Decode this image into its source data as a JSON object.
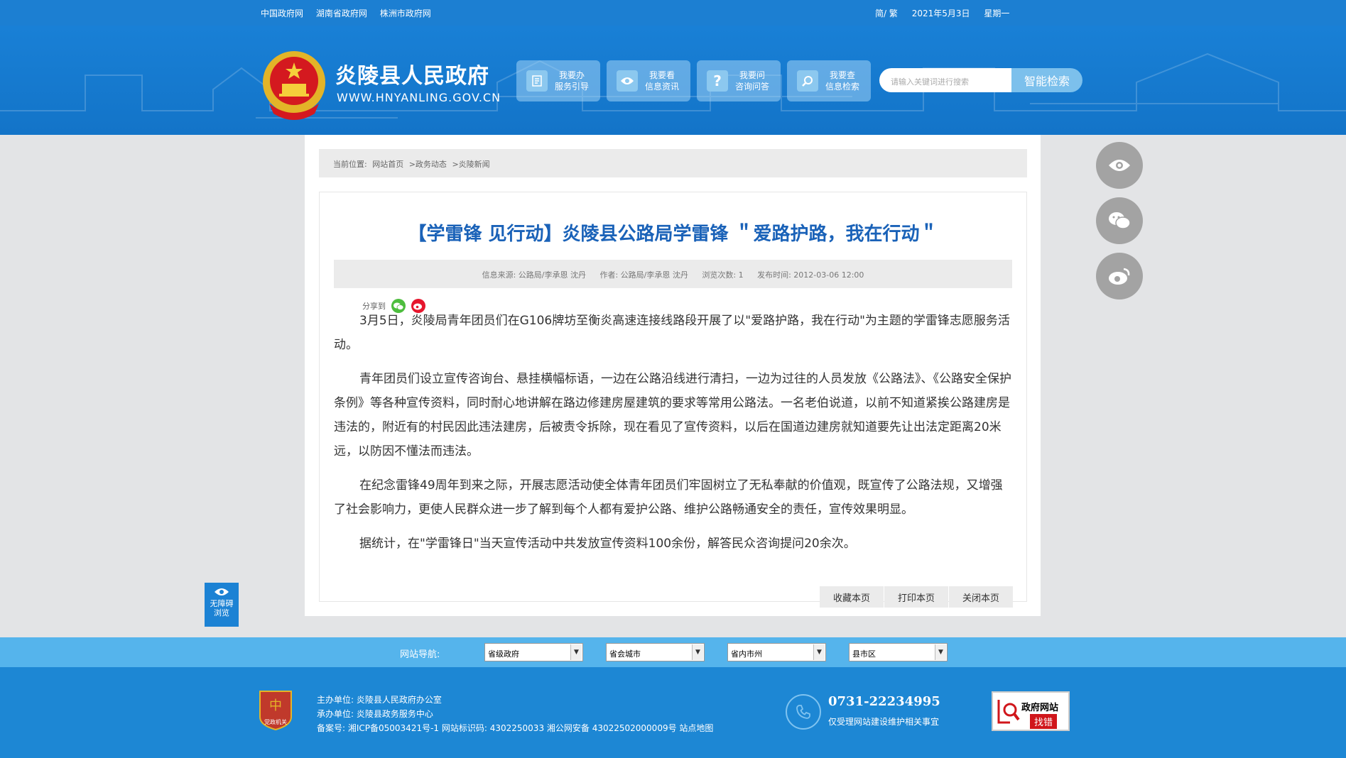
{
  "topbar": {
    "links": [
      "中国政府网",
      "湖南省政府网",
      "株洲市政府网"
    ],
    "script_toggle": "简/ 繁",
    "date": "2021年5月3日",
    "weekday": "星期一"
  },
  "header": {
    "site_name": "炎陵县人民政府",
    "site_url": "WWW.HNYANLING.GOV.CN",
    "buttons": [
      {
        "line1": "我要办",
        "line2": "服务引导",
        "icon": "document-icon"
      },
      {
        "line1": "我要看",
        "line2": "信息资讯",
        "icon": "eye-icon"
      },
      {
        "line1": "我要问",
        "line2": "咨询问答",
        "icon": "question-icon"
      },
      {
        "line1": "我要查",
        "line2": "信息检索",
        "icon": "search-icon"
      }
    ],
    "search_placeholder": "请输入关键词进行搜索",
    "search_button": "智能检索"
  },
  "breadcrumb": {
    "prefix": "当前位置:",
    "items": [
      "网站首页",
      ">政务动态",
      ">炎陵新闻"
    ]
  },
  "article": {
    "title": "【学雷锋 见行动】炎陵县公路局学雷锋 ＂爱路护路，我在行动＂",
    "meta": {
      "source": "信息来源:  公路局/李承恩 沈丹",
      "author": "作者:  公路局/李承恩 沈丹",
      "views": "浏览次数:  1",
      "date": "发布时间:  2012-03-06 12:00"
    },
    "share_label": "分享到",
    "paragraphs": [
      "3月5日，炎陵局青年团员们在G106牌坊至衡炎高速连接线路段开展了以\"爱路护路，我在行动\"为主题的学雷锋志愿服务活动。",
      "青年团员们设立宣传咨询台、悬挂横幅标语，一边在公路沿线进行清扫，一边为过往的人员发放《公路法》、《公路安全保护条例》等各种宣传资料，同时耐心地讲解在路边修建房屋建筑的要求等常用公路法。一名老伯说道，以前不知道紧挨公路建房是违法的，附近有的村民因此违法建房，后被责令拆除，现在看见了宣传资料，以后在国道边建房就知道要先让出法定距离20米远，以防因不懂法而违法。",
      "在纪念雷锋49周年到来之际，开展志愿活动使全体青年团员们牢固树立了无私奉献的价值观，既宣传了公路法规，又增强了社会影响力，更使人民群众进一步了解到每个人都有爱护公路、维护公路畅通安全的责任，宣传效果明显。",
      "据统计，在\"学雷锋日\"当天宣传活动中共发放宣传资料100余份，解答民众咨询提问20余次。"
    ],
    "actions": [
      "收藏本页",
      "打印本页",
      "关闭本页"
    ]
  },
  "floating": {
    "accessibility_line1": "无障碍",
    "accessibility_line2": "浏览"
  },
  "site_nav": {
    "label": "网站导航:",
    "selects": [
      "省级政府",
      "省会城市",
      "省内市州",
      "县市区"
    ]
  },
  "footer": {
    "host": "主办单位:  炎陵县人民政府办公室",
    "organizer": "承办单位:  炎陵县政务服务中心",
    "record": "备案号:  湘ICP备05003421号-1  网站标识码:  4302250033  湘公网安备 43022502000009号  站点地图",
    "phone": "0731-22234995",
    "phone_note": "仅受理网站建设维护相关事宜",
    "gov_badge_line1": "政府网站",
    "gov_badge_line2": "找错",
    "party_badge": "党政机关"
  },
  "colors": {
    "header_blue": "#1676cb",
    "title_blue": "#1a62b8",
    "nav_blue": "#55b4ec",
    "footer_blue": "#1d87d4"
  }
}
